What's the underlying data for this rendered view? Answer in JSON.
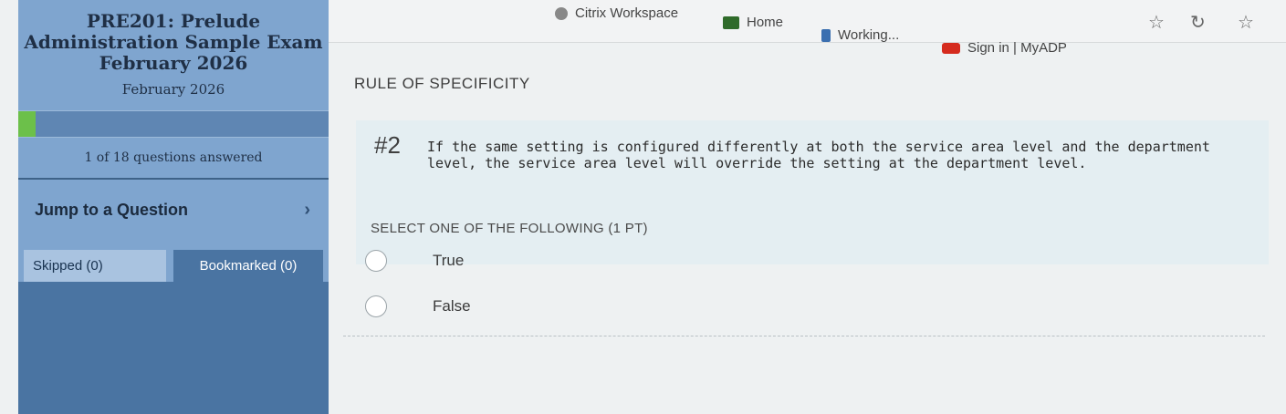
{
  "bookmarks": [
    {
      "label": "Citrix Workspace",
      "icon": "citrix-icon",
      "color": "#7c7c7c"
    },
    {
      "label": "Home",
      "icon": "home-bookmark-icon",
      "color": "#2f6b2a"
    },
    {
      "label": "Working...",
      "icon": "working-bookmark-icon",
      "color": "#3b6fb0"
    },
    {
      "label": "Sign in | MyADP",
      "icon": "adp-icon",
      "color": "#d52b1e"
    }
  ],
  "toolbar": {
    "icons": [
      "star-icon",
      "refresh-icon",
      "favorites-icon"
    ]
  },
  "sidebar": {
    "exam_title": "PRE201: Prelude Administration Sample Exam February 2026",
    "exam_date": "February 2026",
    "progress": 0.0556,
    "answered_text": "1 of 18 questions answered",
    "jump_label": "Jump to a Question",
    "tabs": {
      "skipped": "Skipped (0)",
      "bookmarked": "Bookmarked (0)"
    }
  },
  "question": {
    "section": "RULE OF SPECIFICITY",
    "number": "#2",
    "text": "If the same setting is configured differently at both the service area level and the department level, the service area level will override the setting at the department level.",
    "instruction": "SELECT ONE OF THE FOLLOWING (1 PT)",
    "options": [
      "True",
      "False"
    ]
  },
  "colors": {
    "sidebar": "#4a74a2",
    "sidebar_header": "#7fa5cf",
    "progress_fill": "#6cc04a"
  }
}
